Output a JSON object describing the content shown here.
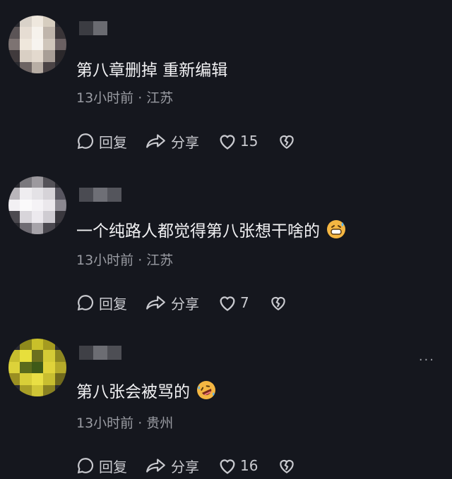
{
  "comments": [
    {
      "text": "第八章删掉 重新编辑",
      "meta": "13小时前 · 江苏",
      "reply_label": "回复",
      "share_label": "分享",
      "likes": "15",
      "avatar_colors": [
        "#2a2a30",
        "#d9d2c9",
        "#efe8de",
        "#d6cdbf",
        "#2a2a30",
        "#5b5456",
        "#e6ddd3",
        "#f6f2ec",
        "#bfb5ab",
        "#3a3538",
        "#7d7372",
        "#efe7dc",
        "#f7f4ef",
        "#cfc6bb",
        "#6a6062",
        "#403a3c",
        "#d9cfc4",
        "#e3d9ce",
        "#a89e96",
        "#2b282b",
        "#2a2a30",
        "#6d6463",
        "#b8aea5",
        "#4a4345",
        "#2a2a30"
      ],
      "name_colors": [
        "#3b3c42",
        "#6a6b71"
      ]
    },
    {
      "text": "一个纯路人都觉得第八张想干啥的",
      "meta": "13小时前 · 江苏",
      "reply_label": "回复",
      "share_label": "分享",
      "likes": "7",
      "avatar_colors": [
        "#2a2a30",
        "#7a787d",
        "#9c999e",
        "#545258",
        "#2a2a30",
        "#b9b6bb",
        "#efedf0",
        "#e4e2e6",
        "#d6d3d8",
        "#585660",
        "#f2f0f3",
        "#fbfafb",
        "#f5f3f6",
        "#ebe8ec",
        "#8b8890",
        "#4c4a50",
        "#d8d5da",
        "#ece9ee",
        "#cfccd2",
        "#3a383e",
        "#2a2a30",
        "#6f6c73",
        "#a6a3a9",
        "#4b4950",
        "#2a2a30"
      ],
      "name_colors": [
        "#4a4b52",
        "#6e6f76",
        "#54555c"
      ]
    },
    {
      "text": "第八张会被骂的",
      "meta": "13小时前 · 贵州",
      "reply_label": "回复",
      "share_label": "分享",
      "likes": "16",
      "more": "···",
      "avatar_colors": [
        "#2a2a30",
        "#8f8a1c",
        "#c9c02a",
        "#a59b20",
        "#2a2a30",
        "#c7be2e",
        "#e7df3c",
        "#6c6f1e",
        "#d5cb36",
        "#8e8720",
        "#dcd23a",
        "#5a6b1c",
        "#3f5a18",
        "#e0d33a",
        "#b5aa2a",
        "#9a8f22",
        "#d9cf38",
        "#e9df44",
        "#c8be30",
        "#716a1c",
        "#2a2a30",
        "#a89e26",
        "#cfc536",
        "#8a8222",
        "#2a2a30"
      ],
      "name_colors": [
        "#3f4046",
        "#6c6d73",
        "#4d4e54"
      ]
    }
  ]
}
